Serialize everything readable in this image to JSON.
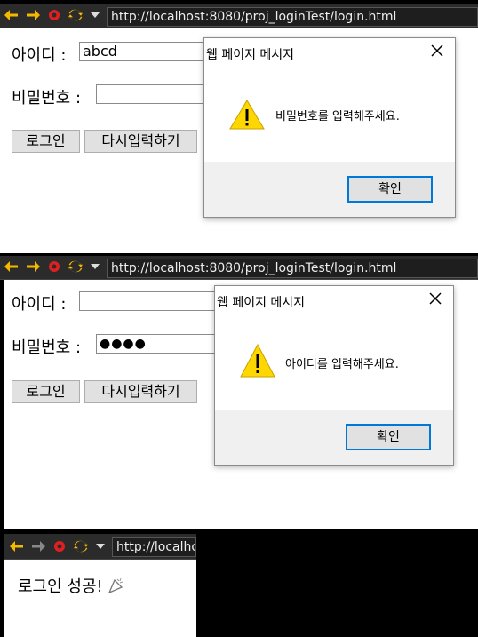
{
  "browser": {
    "url": "http://localhost:8080/proj_loginTest/login.html",
    "url_partial": "http://localho"
  },
  "form": {
    "id_label": "아이디 :",
    "pw_label": "비밀번호 :",
    "login_button": "로그인",
    "reset_button": "다시입력하기"
  },
  "panel1": {
    "id_value": "abcd",
    "pw_value": "",
    "dialog": {
      "title": "웹 페이지 메시지",
      "message": "비밀번호를 입력해주세요.",
      "ok_label": "확인"
    }
  },
  "panel2": {
    "id_value": "",
    "pw_value": "●●●●",
    "dialog": {
      "title": "웹 페이지 메시지",
      "message": "아이디를 입력해주세요.",
      "ok_label": "확인"
    }
  },
  "panel3": {
    "success_text": "로그인 성공!"
  },
  "icons": {
    "back": "back-arrow-icon",
    "forward": "forward-arrow-icon",
    "stop": "stop-icon",
    "refresh": "refresh-icon",
    "menu": "dropdown-icon",
    "warning": "warning-icon",
    "close": "close-icon"
  },
  "colors": {
    "toolbar_bg": "#2b2b2b",
    "arrow": "#f5b800",
    "stop": "#e02020",
    "ok_border": "#0078d7",
    "warning": "#ffd700"
  }
}
